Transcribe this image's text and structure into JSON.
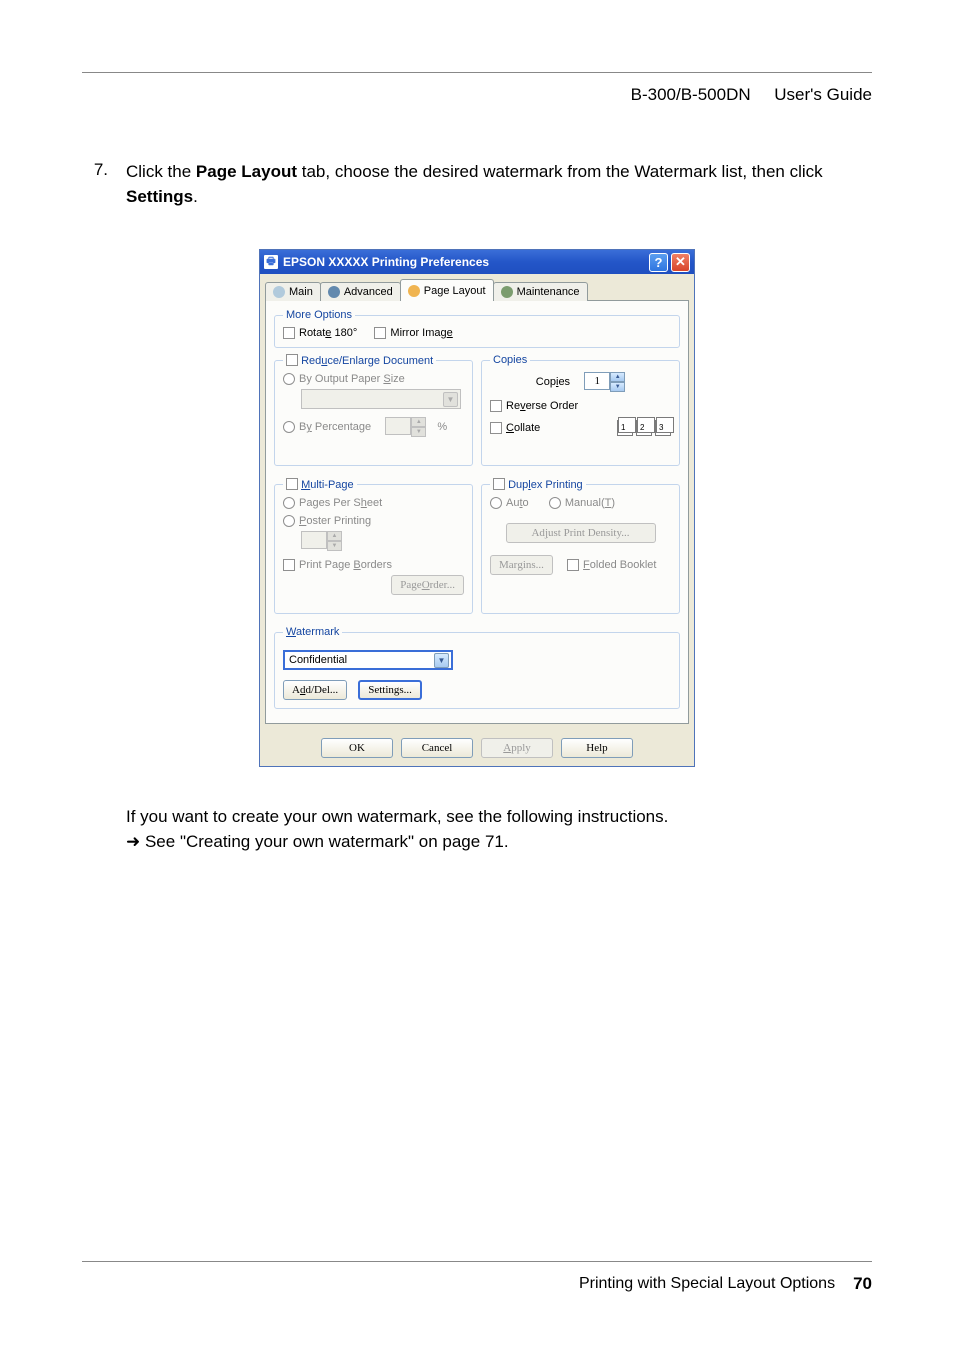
{
  "header": {
    "model": "B-300/B-500DN",
    "guide": "User's Guide"
  },
  "step": {
    "number": "7.",
    "text_pre": "Click the ",
    "bold1": "Page Layout",
    "text_mid": " tab, choose the desired watermark from the Watermark list, then click ",
    "bold2": "Settings",
    "text_post": "."
  },
  "dialog": {
    "title": "EPSON  XXXXX  Printing Preferences",
    "tabs": {
      "main": "Main",
      "advanced": "Advanced",
      "page_layout": "Page Layout",
      "maintenance": "Maintenance"
    },
    "more_options": {
      "legend": "More Options",
      "rotate": "Rotate 180°",
      "mirror": "Mirror Image"
    },
    "reduce_enlarge": {
      "legend": "Reduce/Enlarge Document",
      "by_output": "By Output Paper Size",
      "by_percentage": "By Percentage",
      "percent_unit": "%"
    },
    "copies": {
      "legend": "Copies",
      "label": "Copies",
      "value": "1",
      "reverse": "Reverse Order",
      "collate": "Collate"
    },
    "multipage": {
      "legend": "Multi-Page",
      "pages_per_sheet": "Pages Per Sheet",
      "poster": "Poster Printing",
      "print_borders": "Print Page Borders",
      "page_order_btn": "Page Order..."
    },
    "duplex": {
      "legend": "Duplex Printing",
      "auto": "Auto",
      "manual": "Manual(T)",
      "adjust_density_btn": "Adjust Print Density...",
      "margins_btn": "Margins...",
      "folded_booklet": "Folded Booklet"
    },
    "watermark": {
      "legend": "Watermark",
      "selected": "Confidential",
      "add_del_btn": "Add/Del...",
      "settings_btn": "Settings..."
    },
    "buttons": {
      "ok": "OK",
      "cancel": "Cancel",
      "apply": "Apply",
      "help": "Help"
    }
  },
  "after": {
    "line1": "If you want to create your own watermark, see the following instructions.",
    "pointer": "➜",
    "ref": " See \"Creating your own watermark\" on page 71."
  },
  "footer": {
    "section": "Printing with Special Layout Options",
    "page": "70"
  }
}
